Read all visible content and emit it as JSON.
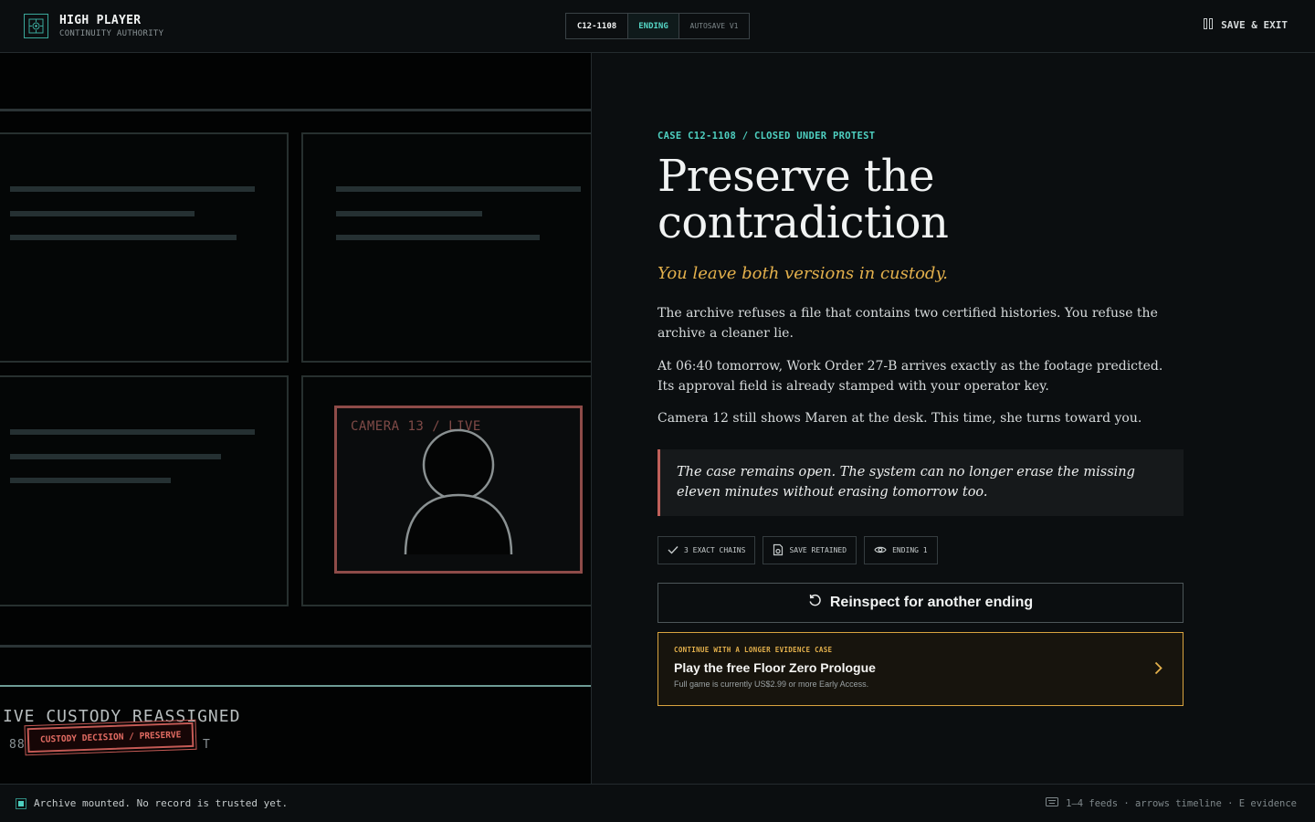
{
  "header": {
    "brand_title": "HIGH PLAYER",
    "brand_subtitle": "CONTINUITY AUTHORITY",
    "tabs": [
      {
        "label": "C12-1108"
      },
      {
        "label": "ENDING"
      },
      {
        "label": "AUTOSAVE V1"
      }
    ],
    "save_exit_label": "SAVE & EXIT"
  },
  "evidence": {
    "camera_label": "CAMERA 13 / LIVE",
    "custody_title": "IVE CUSTODY REASSIGNED",
    "custody_number_prefix": "88",
    "custody_number_suffix": "T",
    "stamp_label": "CUSTODY DECISION / PRESERVE"
  },
  "ending": {
    "kicker": "CASE C12-1108 / CLOSED UNDER PROTEST",
    "title": "Preserve the contradiction",
    "subtitle": "You leave both versions in custody.",
    "paragraphs": [
      "The archive refuses a file that contains two certified histories. You refuse the archive a cleaner lie.",
      "At 06:40 tomorrow, Work Order 27-B arrives exactly as the footage predicted. Its approval field is already stamped with your operator key.",
      "Camera 12 still shows Maren at the desk. This time, she turns toward you."
    ],
    "quote": "The case remains open. The system can no longer erase the missing eleven minutes without erasing tomorrow too.",
    "badges": [
      {
        "icon": "check-icon",
        "label": "3 EXACT CHAINS"
      },
      {
        "icon": "save-icon",
        "label": "SAVE RETAINED"
      },
      {
        "icon": "eye-icon",
        "label": "ENDING 1"
      }
    ],
    "reinspect_label": "Reinspect for another ending",
    "cta": {
      "kicker": "CONTINUE WITH A LONGER EVIDENCE CASE",
      "title": "Play the free Floor Zero Prologue",
      "subtitle": "Full game is currently US$2.99 or more Early Access."
    }
  },
  "footer": {
    "status": "Archive mounted. No record is trusted yet.",
    "hints": "1–4 feeds · arrows timeline · E evidence"
  },
  "colors": {
    "accent_teal": "#4ecfc0",
    "accent_gold": "#e3b04c",
    "accent_red": "#c0605a"
  }
}
